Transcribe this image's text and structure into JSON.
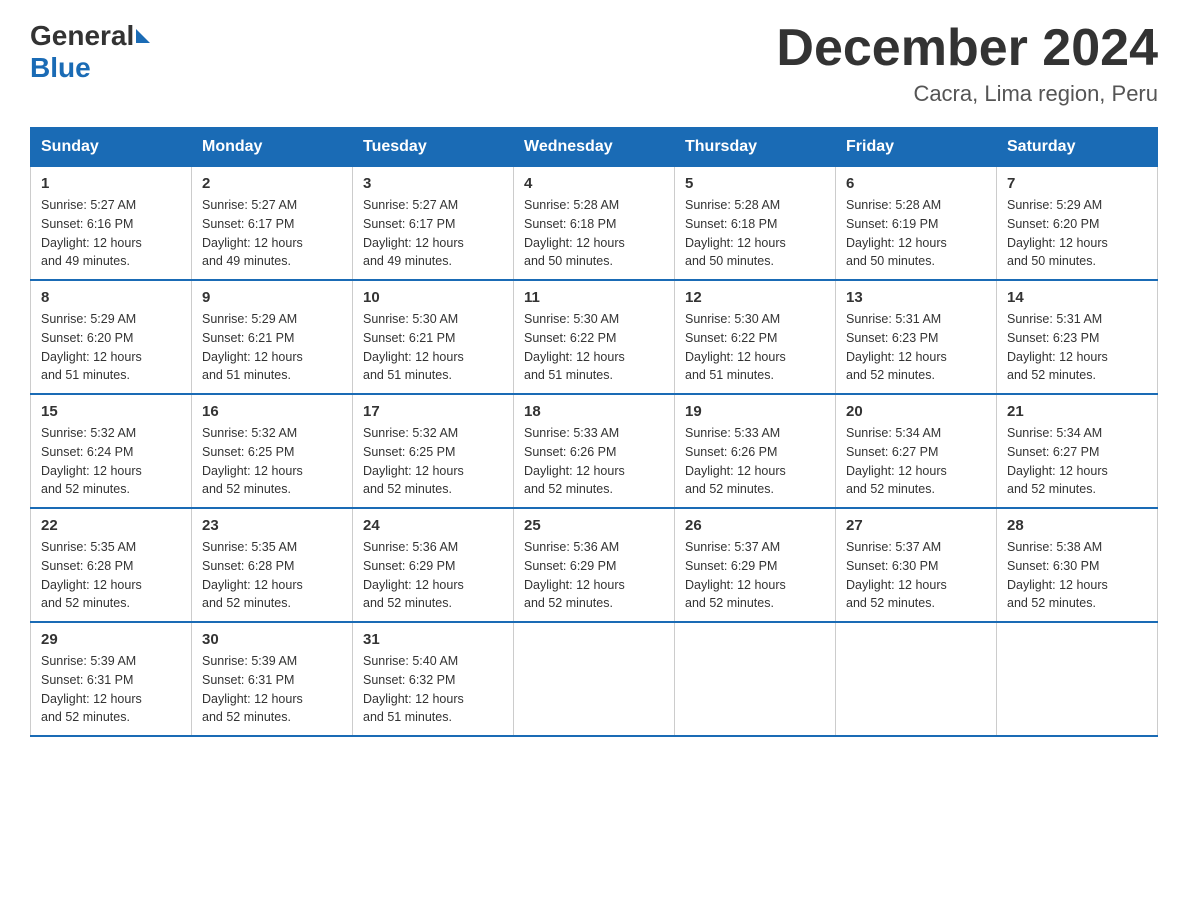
{
  "header": {
    "logo_general": "General",
    "logo_blue": "Blue",
    "month_title": "December 2024",
    "subtitle": "Cacra, Lima region, Peru"
  },
  "days_of_week": [
    "Sunday",
    "Monday",
    "Tuesday",
    "Wednesday",
    "Thursday",
    "Friday",
    "Saturday"
  ],
  "weeks": [
    [
      {
        "day": "1",
        "sunrise": "5:27 AM",
        "sunset": "6:16 PM",
        "daylight": "12 hours and 49 minutes."
      },
      {
        "day": "2",
        "sunrise": "5:27 AM",
        "sunset": "6:17 PM",
        "daylight": "12 hours and 49 minutes."
      },
      {
        "day": "3",
        "sunrise": "5:27 AM",
        "sunset": "6:17 PM",
        "daylight": "12 hours and 49 minutes."
      },
      {
        "day": "4",
        "sunrise": "5:28 AM",
        "sunset": "6:18 PM",
        "daylight": "12 hours and 50 minutes."
      },
      {
        "day": "5",
        "sunrise": "5:28 AM",
        "sunset": "6:18 PM",
        "daylight": "12 hours and 50 minutes."
      },
      {
        "day": "6",
        "sunrise": "5:28 AM",
        "sunset": "6:19 PM",
        "daylight": "12 hours and 50 minutes."
      },
      {
        "day": "7",
        "sunrise": "5:29 AM",
        "sunset": "6:20 PM",
        "daylight": "12 hours and 50 minutes."
      }
    ],
    [
      {
        "day": "8",
        "sunrise": "5:29 AM",
        "sunset": "6:20 PM",
        "daylight": "12 hours and 51 minutes."
      },
      {
        "day": "9",
        "sunrise": "5:29 AM",
        "sunset": "6:21 PM",
        "daylight": "12 hours and 51 minutes."
      },
      {
        "day": "10",
        "sunrise": "5:30 AM",
        "sunset": "6:21 PM",
        "daylight": "12 hours and 51 minutes."
      },
      {
        "day": "11",
        "sunrise": "5:30 AM",
        "sunset": "6:22 PM",
        "daylight": "12 hours and 51 minutes."
      },
      {
        "day": "12",
        "sunrise": "5:30 AM",
        "sunset": "6:22 PM",
        "daylight": "12 hours and 51 minutes."
      },
      {
        "day": "13",
        "sunrise": "5:31 AM",
        "sunset": "6:23 PM",
        "daylight": "12 hours and 52 minutes."
      },
      {
        "day": "14",
        "sunrise": "5:31 AM",
        "sunset": "6:23 PM",
        "daylight": "12 hours and 52 minutes."
      }
    ],
    [
      {
        "day": "15",
        "sunrise": "5:32 AM",
        "sunset": "6:24 PM",
        "daylight": "12 hours and 52 minutes."
      },
      {
        "day": "16",
        "sunrise": "5:32 AM",
        "sunset": "6:25 PM",
        "daylight": "12 hours and 52 minutes."
      },
      {
        "day": "17",
        "sunrise": "5:32 AM",
        "sunset": "6:25 PM",
        "daylight": "12 hours and 52 minutes."
      },
      {
        "day": "18",
        "sunrise": "5:33 AM",
        "sunset": "6:26 PM",
        "daylight": "12 hours and 52 minutes."
      },
      {
        "day": "19",
        "sunrise": "5:33 AM",
        "sunset": "6:26 PM",
        "daylight": "12 hours and 52 minutes."
      },
      {
        "day": "20",
        "sunrise": "5:34 AM",
        "sunset": "6:27 PM",
        "daylight": "12 hours and 52 minutes."
      },
      {
        "day": "21",
        "sunrise": "5:34 AM",
        "sunset": "6:27 PM",
        "daylight": "12 hours and 52 minutes."
      }
    ],
    [
      {
        "day": "22",
        "sunrise": "5:35 AM",
        "sunset": "6:28 PM",
        "daylight": "12 hours and 52 minutes."
      },
      {
        "day": "23",
        "sunrise": "5:35 AM",
        "sunset": "6:28 PM",
        "daylight": "12 hours and 52 minutes."
      },
      {
        "day": "24",
        "sunrise": "5:36 AM",
        "sunset": "6:29 PM",
        "daylight": "12 hours and 52 minutes."
      },
      {
        "day": "25",
        "sunrise": "5:36 AM",
        "sunset": "6:29 PM",
        "daylight": "12 hours and 52 minutes."
      },
      {
        "day": "26",
        "sunrise": "5:37 AM",
        "sunset": "6:29 PM",
        "daylight": "12 hours and 52 minutes."
      },
      {
        "day": "27",
        "sunrise": "5:37 AM",
        "sunset": "6:30 PM",
        "daylight": "12 hours and 52 minutes."
      },
      {
        "day": "28",
        "sunrise": "5:38 AM",
        "sunset": "6:30 PM",
        "daylight": "12 hours and 52 minutes."
      }
    ],
    [
      {
        "day": "29",
        "sunrise": "5:39 AM",
        "sunset": "6:31 PM",
        "daylight": "12 hours and 52 minutes."
      },
      {
        "day": "30",
        "sunrise": "5:39 AM",
        "sunset": "6:31 PM",
        "daylight": "12 hours and 52 minutes."
      },
      {
        "day": "31",
        "sunrise": "5:40 AM",
        "sunset": "6:32 PM",
        "daylight": "12 hours and 51 minutes."
      },
      null,
      null,
      null,
      null
    ]
  ],
  "labels": {
    "sunrise": "Sunrise:",
    "sunset": "Sunset:",
    "daylight": "Daylight:"
  }
}
